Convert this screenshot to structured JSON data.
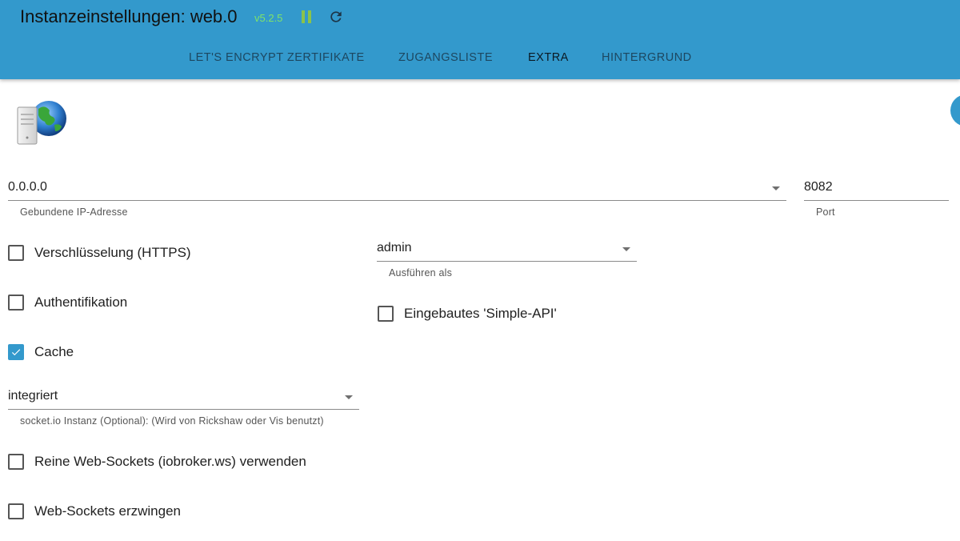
{
  "header": {
    "title": "Instanzeinstellungen: web.0",
    "version": "v5.2.5",
    "tabs": [
      {
        "label": "LET'S ENCRYPT ZERTIFIKATE"
      },
      {
        "label": "ZUGANGSLISTE"
      },
      {
        "label": "EXTRA"
      },
      {
        "label": "HINTERGRUND"
      }
    ]
  },
  "form": {
    "bind_ip": {
      "value": "0.0.0.0",
      "label": "Gebundene IP-Adresse"
    },
    "port": {
      "value": "8082",
      "label": "Port"
    },
    "https": {
      "label": "Verschlüsselung (HTTPS)",
      "checked": false
    },
    "run_as": {
      "value": "admin",
      "label": "Ausführen als"
    },
    "auth": {
      "label": "Authentifikation",
      "checked": false
    },
    "simple_api": {
      "label": "Eingebautes 'Simple-API'",
      "checked": false
    },
    "cache": {
      "label": "Cache",
      "checked": true
    },
    "socketio": {
      "value": "integriert",
      "label": "socket.io Instanz (Optional): (Wird von Rickshaw oder Vis benutzt)"
    },
    "pure_ws": {
      "label": "Reine Web-Sockets (iobroker.ws) verwenden",
      "checked": false
    },
    "force_ws": {
      "label": "Web-Sockets erzwingen",
      "checked": false
    }
  },
  "colors": {
    "header_bg": "#3399cc",
    "version": "#7fe36a",
    "pause": "#8bc34a",
    "checkbox_checked": "#3399cc"
  },
  "icons": {
    "pause": "pause-icon",
    "reload": "reload-icon",
    "logo": "server-globe-icon",
    "check": "checkmark-icon",
    "dropdown": "dropdown-arrow-icon"
  }
}
